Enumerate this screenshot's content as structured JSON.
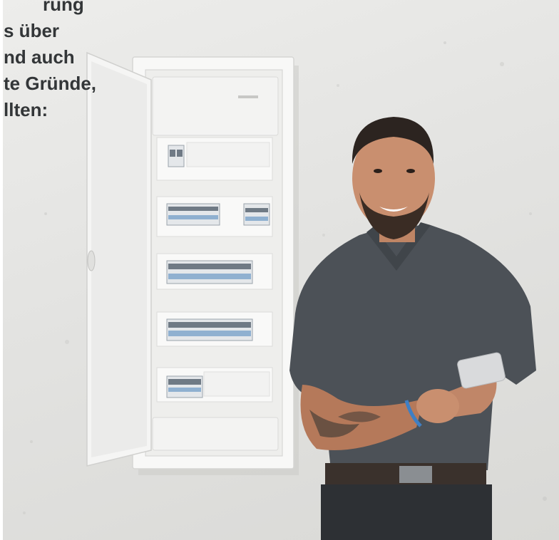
{
  "text_fragment": {
    "lines": [
      "rung",
      "s über",
      "nd auch",
      "te Gründe,",
      "llten:"
    ]
  },
  "photo": {
    "subject": "person",
    "colors": {
      "wall": "#e4e4e2",
      "cabinet": "#f7f7f6",
      "shirt": "#4c5157",
      "skin": "#c98f6f",
      "phone": "#d9dadc"
    }
  }
}
